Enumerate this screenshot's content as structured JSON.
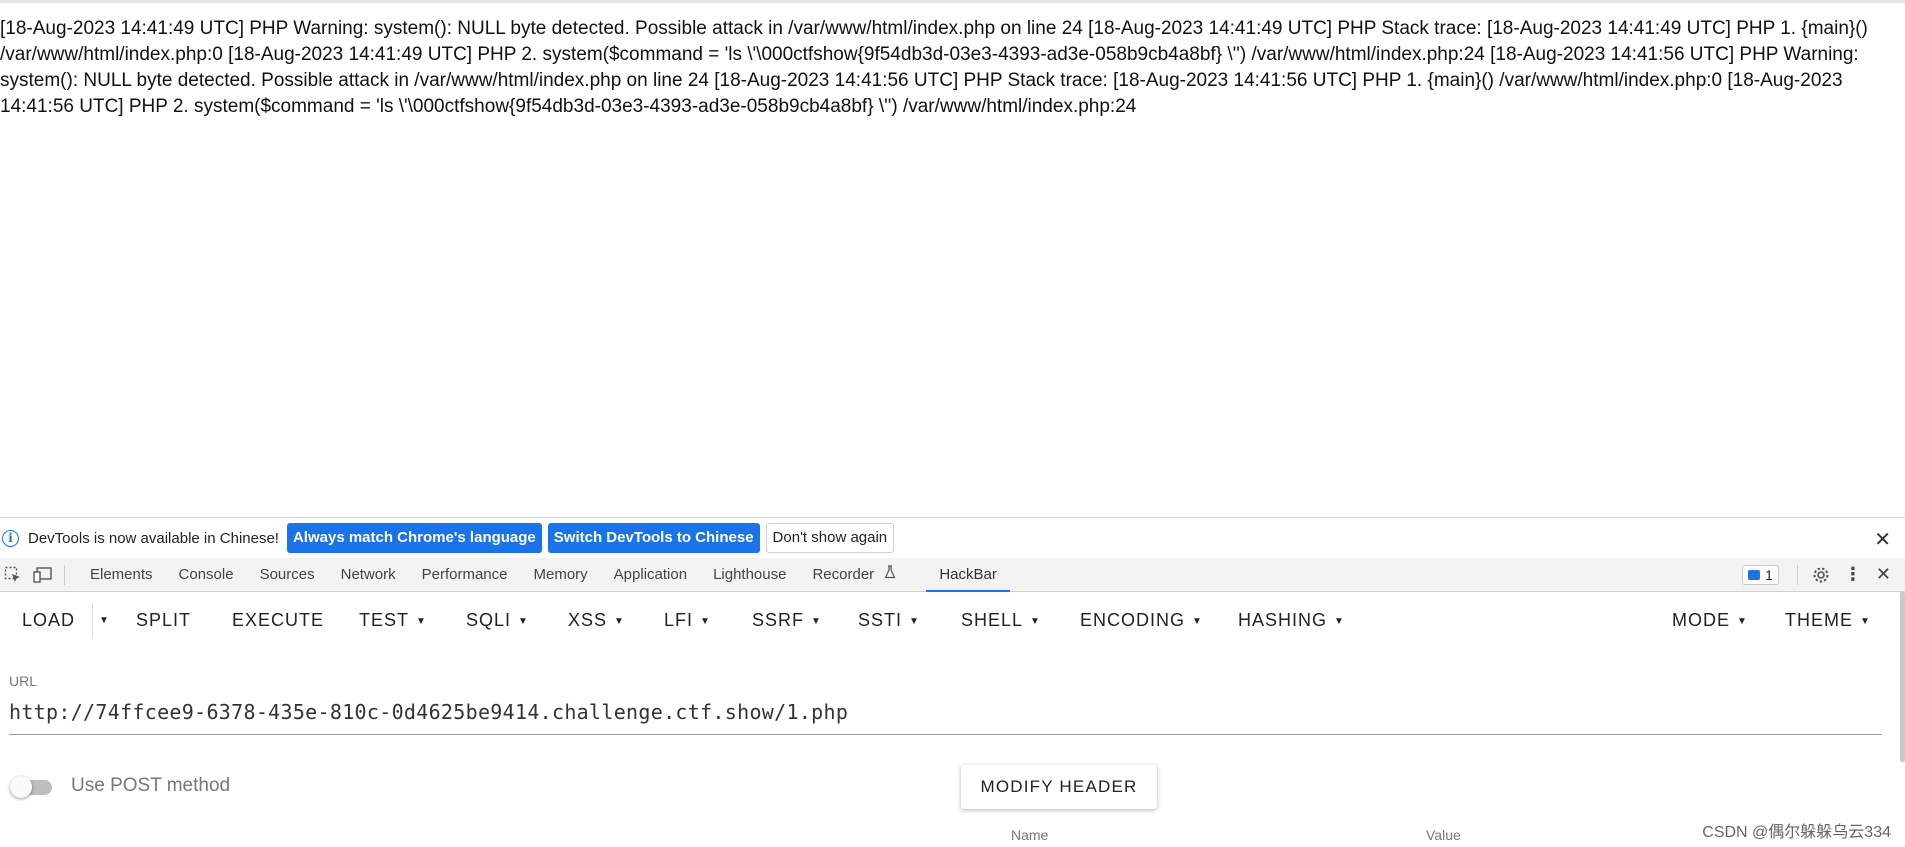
{
  "page": {
    "output_text": "[18-Aug-2023 14:41:49 UTC] PHP Warning: system(): NULL byte detected. Possible attack in /var/www/html/index.php on line 24 [18-Aug-2023 14:41:49 UTC] PHP Stack trace: [18-Aug-2023 14:41:49 UTC] PHP 1. {main}() /var/www/html/index.php:0 [18-Aug-2023 14:41:49 UTC] PHP 2. system($command = 'ls \\'\\000ctfshow{9f54db3d-03e3-4393-ad3e-058b9cb4a8bf} \\'') /var/www/html/index.php:24 [18-Aug-2023 14:41:56 UTC] PHP Warning: system(): NULL byte detected. Possible attack in /var/www/html/index.php on line 24 [18-Aug-2023 14:41:56 UTC] PHP Stack trace: [18-Aug-2023 14:41:56 UTC] PHP 1. {main}() /var/www/html/index.php:0 [18-Aug-2023 14:41:56 UTC] PHP 2. system($command = 'ls \\'\\000ctfshow{9f54db3d-03e3-4393-ad3e-058b9cb4a8bf} \\'') /var/www/html/index.php:24"
  },
  "info_bar": {
    "message": "DevTools is now available in Chinese!",
    "match_language_button": "Always match Chrome's language",
    "switch_button": "Switch DevTools to Chinese",
    "dismiss_button": "Don't show again"
  },
  "devtools": {
    "tabs": [
      "Elements",
      "Console",
      "Sources",
      "Network",
      "Performance",
      "Memory",
      "Application",
      "Lighthouse",
      "Recorder",
      "HackBar"
    ],
    "active_tab": "HackBar",
    "issues_count": "1"
  },
  "hackbar": {
    "toolbar": {
      "load": "LOAD",
      "split": "SPLIT",
      "execute": "EXECUTE",
      "test": "TEST",
      "sqli": "SQLI",
      "xss": "XSS",
      "lfi": "LFI",
      "ssrf": "SSRF",
      "ssti": "SSTI",
      "shell": "SHELL",
      "encoding": "ENCODING",
      "hashing": "HASHING",
      "mode": "MODE",
      "theme": "THEME"
    },
    "url_label": "URL",
    "url_value": "http://74ffcee9-6378-435e-810c-0d4625be9414.challenge.ctf.show/1.php",
    "post_method_label": "Use POST method",
    "post_method_enabled": false,
    "modify_header_button": "MODIFY HEADER",
    "header_columns": {
      "name": "Name",
      "value": "Value"
    }
  },
  "watermark": "CSDN @偶尔躲躲乌云334",
  "colors": {
    "accent": "#1a73e8"
  }
}
